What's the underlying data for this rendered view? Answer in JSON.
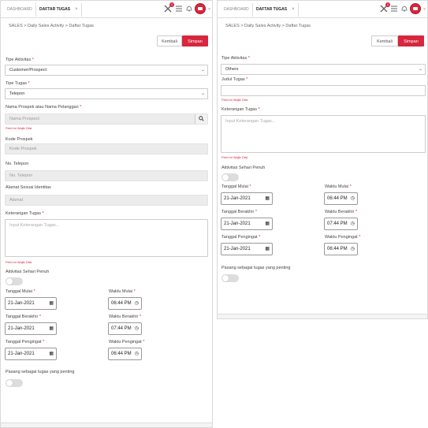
{
  "colors": {
    "accent": "#d7263d",
    "disabled_bg": "#ececec"
  },
  "tabs": {
    "dashboard": "DASHBOARD",
    "daftar_tugas": "DAFTAR TUGAS"
  },
  "topbar": {
    "notif_count": "1"
  },
  "breadcrumb": {
    "text": "SALES > Daily Sales Activity > Daftar Tugas"
  },
  "buttons": {
    "back": "Kembali",
    "save": "Simpan"
  },
  "left": {
    "tipe_aktivitas_label": "Tipe Aktivitas",
    "tipe_aktivitas_value": "Customer/Prospect",
    "tipe_tugas_label": "Tipe Tugas",
    "tipe_tugas_value": "Telepon",
    "nama_prospek_label": "Nama Prospek atau Nama Pelanggan",
    "nama_prospek_placeholder": "Nama Prospect",
    "nama_error": "Field ini Wajib Diisi",
    "kode_prospek_label": "Kode Prospek",
    "kode_prospek_placeholder": "Kode Prospek",
    "no_telepon_label": "No. Telepon",
    "no_telepon_placeholder": "No. Telepon",
    "alamat_label": "Alamat Sesuai Identitas",
    "alamat_placeholder": "Alamat",
    "keterangan_label": "Keterangan Tugas",
    "keterangan_placeholder": "Input Keterangan Tugas...",
    "keterangan_error": "Field ini Wajib Diisi",
    "aktivitas_label": "Aktivitas Sehari Penuh",
    "tanggal_mulai_label": "Tanggal Mulai",
    "tanggal_mulai_value": "21-Jan-2021",
    "waktu_mulai_label": "Waktu Mulai",
    "waktu_mulai_value": "06:44 PM",
    "tanggal_berakhir_label": "Tanggal Berakhir",
    "tanggal_berakhir_value": "21-Jan-2021",
    "waktu_berakhir_label": "Waktu Berakhir",
    "waktu_berakhir_value": "07:44 PM",
    "tanggal_pengingat_label": "Tanggal Pengingat",
    "tanggal_pengingat_value": "21-Jan-2021",
    "waktu_pengingat_label": "Waktu Pengingat",
    "waktu_pengingat_value": "06:44 PM",
    "pasang_label": "Pasang sebagai tugas yang penting"
  },
  "right": {
    "tipe_aktivitas_label": "Tipe Aktivitas",
    "tipe_aktivitas_value": "Others",
    "judul_label": "Judul Tugas",
    "judul_error": "Field ini Wajib Diisi",
    "keterangan_label": "Keterangan Tugas",
    "keterangan_placeholder": "Input Keterangan Tugas...",
    "keterangan_error": "Field ini Wajib Diisi",
    "aktivitas_label": "Aktivitas Sehari Penuh",
    "tanggal_mulai_label": "Tanggal Mulai",
    "tanggal_mulai_value": "21-Jan-2021",
    "waktu_mulai_label": "Waktu Mulai",
    "waktu_mulai_value": "06:44 PM",
    "tanggal_berakhir_label": "Tanggal Berakhir",
    "tanggal_berakhir_value": "21-Jan-2021",
    "waktu_berakhir_label": "Waktu Berakhir",
    "waktu_berakhir_value": "07:44 PM",
    "tanggal_pengingat_label": "Tanggal Pengingat",
    "tanggal_pengingat_value": "21-Jan-2021",
    "waktu_pengingat_label": "Waktu Pengingat",
    "waktu_pengingat_value": "06:44 PM",
    "pasang_label": "Pasang sebagai tugas yang penting"
  }
}
